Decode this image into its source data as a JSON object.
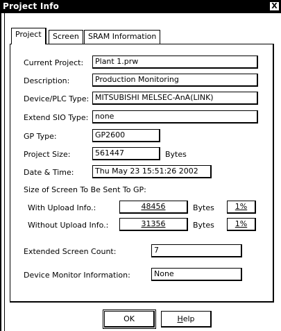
{
  "window": {
    "title": "Project Info",
    "close_glyph": "X"
  },
  "tabs": [
    {
      "label": "Project",
      "active": true
    },
    {
      "label": "Screen",
      "active": false
    },
    {
      "label": "SRAM Information",
      "active": false
    }
  ],
  "project": {
    "current_project": {
      "label": "Current Project:",
      "value": "Plant 1.prw"
    },
    "description": {
      "label": "Description:",
      "value": "Production Monitoring"
    },
    "device_plc": {
      "label": "Device/PLC Type:",
      "value": "MITSUBISHI MELSEC-AnA(LINK)"
    },
    "extend_sio": {
      "label": "Extend SIO Type:",
      "value": "none"
    },
    "gp_type": {
      "label": "GP Type:",
      "value": "GP2600"
    },
    "project_size": {
      "label": "Project Size:",
      "value": "561447",
      "unit": "Bytes"
    },
    "date_time": {
      "label": "Date & Time:",
      "value": "Thu May 23 15:51:26 2002"
    },
    "screen_size_heading": "Size of Screen To Be Sent To GP:",
    "with_upload": {
      "label": "With Upload Info.:",
      "value": "48456",
      "unit": "Bytes",
      "percent": "1%"
    },
    "without_upload": {
      "label": "Without Upload Info.:",
      "value": "31356",
      "unit": "Bytes",
      "percent": "1%"
    },
    "extended_screen_count": {
      "label": "Extended Screen Count:",
      "value": "7"
    },
    "device_monitor": {
      "label": "Device Monitor Information:",
      "value": "None"
    }
  },
  "buttons": {
    "ok": "OK",
    "help_prefix": "",
    "help_mnemonic": "H",
    "help_rest": "elp"
  }
}
